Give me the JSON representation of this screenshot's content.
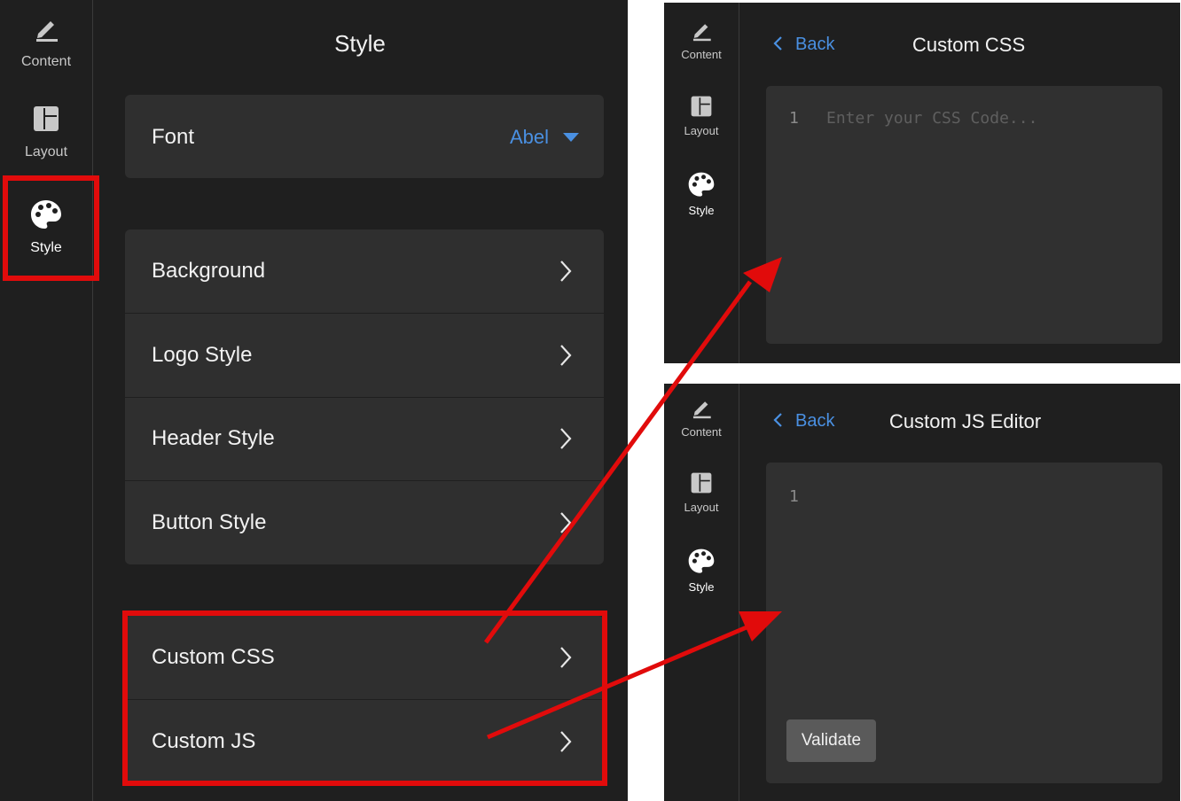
{
  "rail": {
    "content_label": "Content",
    "layout_label": "Layout",
    "style_label": "Style"
  },
  "main": {
    "title": "Style",
    "font": {
      "label": "Font",
      "value": "Abel"
    },
    "style_items": [
      {
        "label": "Background"
      },
      {
        "label": "Logo Style"
      },
      {
        "label": "Header Style"
      },
      {
        "label": "Button Style"
      }
    ],
    "custom_items": [
      {
        "label": "Custom CSS"
      },
      {
        "label": "Custom JS"
      }
    ]
  },
  "css_panel": {
    "back_label": "Back",
    "title": "Custom CSS",
    "line_number": "1",
    "placeholder": "Enter your CSS Code..."
  },
  "js_panel": {
    "back_label": "Back",
    "title": "Custom JS Editor",
    "line_number": "1",
    "validate_label": "Validate"
  },
  "colors": {
    "accent_blue": "#4a90e2",
    "highlight_red": "#e10b0b",
    "background_dark": "#1f1f1f",
    "card": "#2f2f2f"
  },
  "icons": [
    "pencil-icon",
    "layout-icon",
    "palette-icon",
    "chevron-right-icon",
    "chevron-left-icon",
    "caret-down-icon"
  ]
}
